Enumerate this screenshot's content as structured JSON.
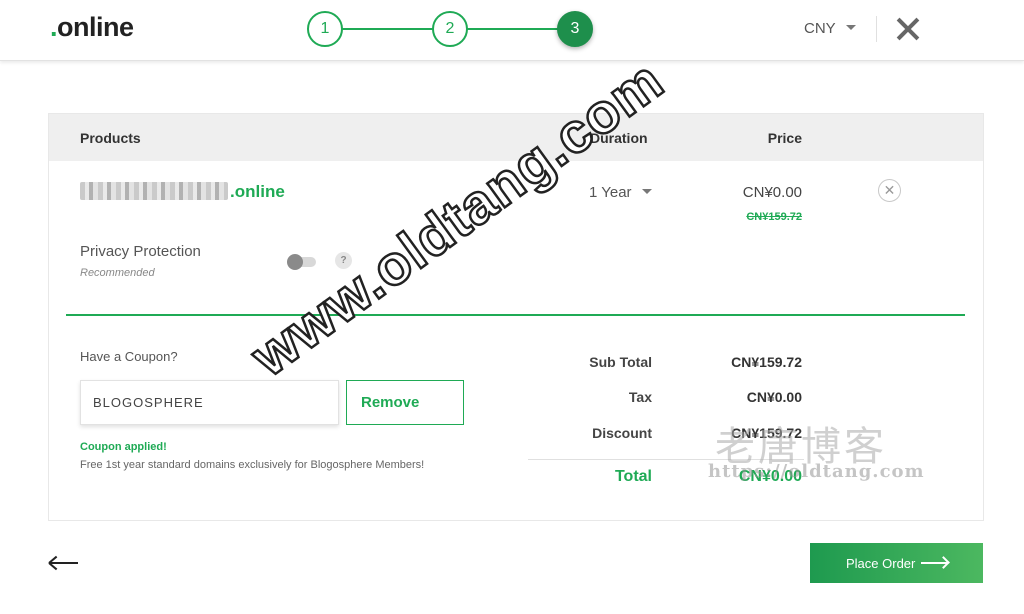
{
  "header": {
    "logo": ".online",
    "steps": [
      "1",
      "2",
      "3"
    ],
    "active_step": 3,
    "currency": "CNY"
  },
  "table": {
    "col_products": "Products",
    "col_duration": "Duration",
    "col_price": "Price"
  },
  "item": {
    "domain_suffix": ".online",
    "duration": "1 Year",
    "price": "CN¥0.00",
    "original_price": "CN¥159.72",
    "remove_icon": "close-circle-icon"
  },
  "privacy": {
    "label": "Privacy Protection",
    "sublabel": "Recommended",
    "enabled": false,
    "help": "?"
  },
  "coupon": {
    "question": "Have a Coupon?",
    "code": "BLOGOSPHERE",
    "remove_label": "Remove",
    "applied_label": "Coupon applied!",
    "note": "Free 1st year standard domains exclusively for Blogosphere Members!"
  },
  "summary": {
    "subtotal_label": "Sub Total",
    "subtotal": "CN¥159.72",
    "tax_label": "Tax",
    "tax": "CN¥0.00",
    "discount_label": "Discount",
    "discount": "CN¥159.72",
    "total_label": "Total",
    "total": "CN¥0.00"
  },
  "footer": {
    "place_order": "Place Order"
  },
  "watermarks": {
    "main": "www.oldtang.com",
    "chinese": "老唐博客",
    "url": "https://oldtang.com"
  },
  "colors": {
    "accent": "#1faa55",
    "active_step": "#1e8f4c"
  }
}
